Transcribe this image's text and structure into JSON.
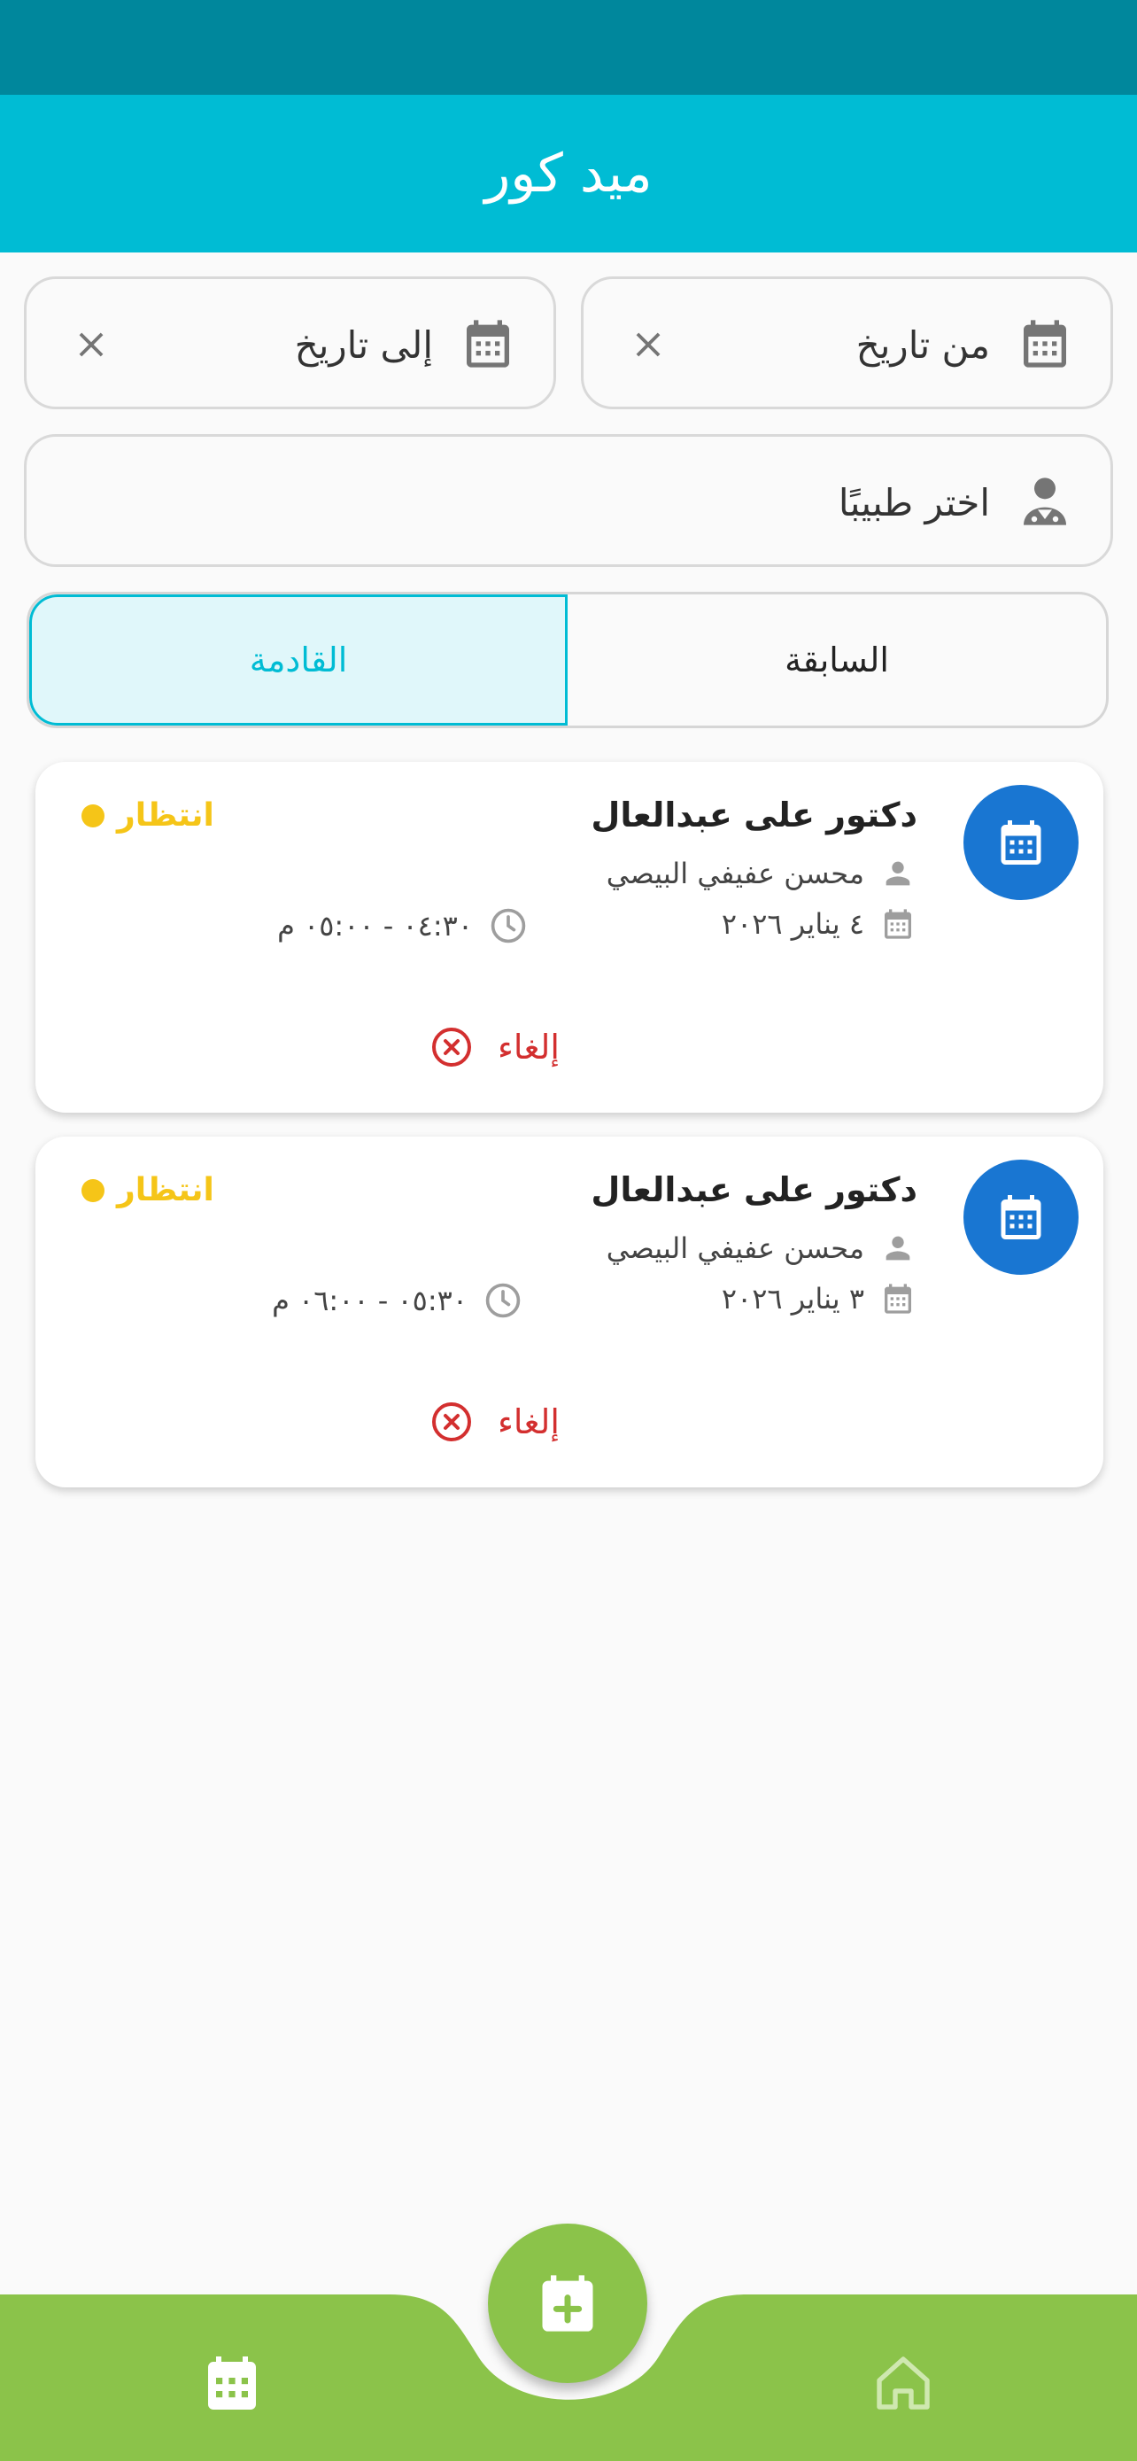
{
  "app": {
    "title": "ميد كور"
  },
  "filters": {
    "from_date_label": "من تاريخ",
    "to_date_label": "إلى تاريخ",
    "doctor_label": "اختر طبيبًا"
  },
  "tabs": {
    "previous": "السابقة",
    "upcoming": "القادمة",
    "selected": "upcoming"
  },
  "appointments": [
    {
      "doctor": "دكتور على عبدالعال",
      "patient": "محسن عفيفي البيصي",
      "date": "٤ يناير ٢٠٢٦",
      "time": "٠٤:٣٠ - ٠٥:٠٠ م",
      "status": "انتظار",
      "cancel_label": "إلغاء"
    },
    {
      "doctor": "دكتور على عبدالعال",
      "patient": "محسن عفيفي البيصي",
      "date": "٣ يناير ٢٠٢٦",
      "time": "٠٥:٣٠ - ٠٦:٠٠ م",
      "status": "انتظار",
      "cancel_label": "إلغاء"
    }
  ],
  "colors": {
    "status_bar": "#00879c",
    "app_bar": "#00bcd4",
    "avatar": "#1976d2",
    "pending": "#f5c518",
    "cancel": "#d32f2f",
    "nav": "#8bc34a"
  },
  "nav": {
    "left_icon": "calendar-icon",
    "center_icon": "calendar-plus-icon",
    "right_icon": "home-icon"
  }
}
